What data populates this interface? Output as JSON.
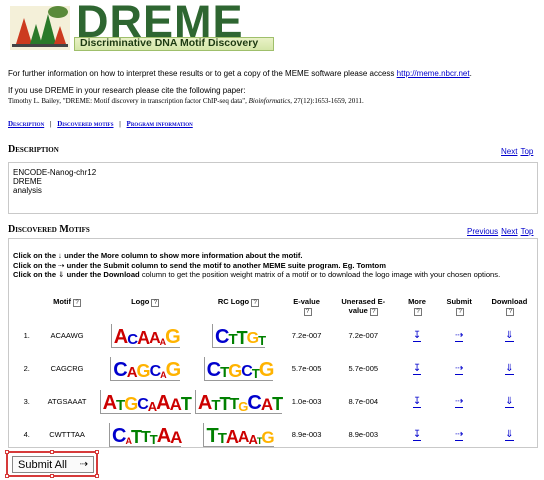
{
  "header": {
    "title": "DREME",
    "tagline": "Discriminative DNA Motif Discovery"
  },
  "info": {
    "line1_text": "For further information on how to interpret these results or to get a copy of the MEME software please access",
    "line1_link": "http://meme.nbcr.net",
    "line1_end": ".",
    "line2": "If you use DREME in your research please cite the following paper:",
    "citation_pre": "Timothy L. Bailey, \"DREME: Motif discovery in transcription factor ChIP-seq data\",",
    "citation_journal": "Bioinformatics",
    "citation_post": ", 27(12):1653-1659, 2011."
  },
  "nav": {
    "description": "Description",
    "discovered": "Discovered motifs",
    "program": "Program information",
    "sep": "|"
  },
  "description": {
    "title": "Description",
    "next": "Next",
    "top": "Top",
    "lines": [
      "ENCODE-Nanog-chr12",
      "DREME",
      "analysis"
    ]
  },
  "motifs_section": {
    "title": "Discovered Motifs",
    "previous": "Previous",
    "next": "Next",
    "top": "Top",
    "instr1_a": "Click on the",
    "instr1_b": "↓",
    "instr1_c": "under the",
    "instr1_d": "More",
    "instr1_e": "column to show more information about the motif.",
    "instr2_a": "Click on the",
    "instr2_b": "⇢",
    "instr2_c": "under the",
    "instr2_d": "Submit",
    "instr2_e": "column to send the motif to another MEME suite program. Eg. Tomtom",
    "instr3_a": "Click on the",
    "instr3_b": "⇓",
    "instr3_c": "under the",
    "instr3_d": "Download",
    "instr3_e": "column to get the position weight matrix of a motif or to download the logo image with your chosen options.",
    "columns": {
      "motif": "Motif",
      "logo": "Logo",
      "rclogo": "RC Logo",
      "evalue": "E-value",
      "unerased_a": "Unerased E-",
      "unerased_b": "value",
      "more": "More",
      "submit": "Submit",
      "download": "Download",
      "help": "?"
    },
    "rows": [
      {
        "num": "1.",
        "motif": "ACAAWG",
        "logo": "ACAAaG",
        "rclogo": "CTTGT",
        "evalue": "7.2e-007",
        "unerased": "7.2e-007"
      },
      {
        "num": "2.",
        "motif": "CAGCRG",
        "logo": "CAGCaG",
        "rclogo": "CTGCTG",
        "evalue": "5.7e-005",
        "unerased": "5.7e-005"
      },
      {
        "num": "3.",
        "motif": "ATGSAAAT",
        "logo": "ATGCAAAT",
        "rclogo": "ATTTGCAT",
        "evalue": "1.0e-003",
        "unerased": "8.7e-004"
      },
      {
        "num": "4.",
        "motif": "CWTTTAA",
        "logo": "CaTTTAA",
        "rclogo": "TTAAAtG",
        "evalue": "8.9e-003",
        "unerased": "8.9e-003"
      }
    ],
    "more_icon": "↧",
    "submit_icon": "⇢",
    "download_icon": "⇓"
  },
  "submit_all": {
    "label": "Submit All",
    "arrow": "⇢"
  },
  "colors": {
    "brand_green": "#2e6631",
    "link_blue": "#0000cc",
    "base_A": "#cc0000",
    "base_C": "#0000cc",
    "base_G": "#ffb300",
    "base_T": "#008000",
    "selection_red": "#d63a3a"
  }
}
